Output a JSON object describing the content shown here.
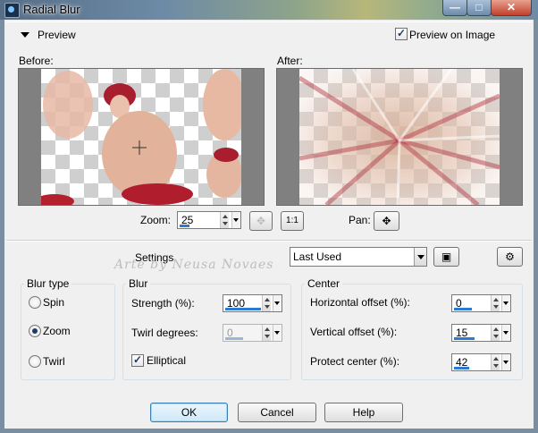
{
  "window": {
    "title": "Radial Blur",
    "min_label": "—",
    "max_label": "□",
    "close_label": "✕"
  },
  "preview_section": {
    "label": "Preview",
    "preview_on_image_label": "Preview on Image",
    "preview_on_image_checked": true
  },
  "before_label": "Before:",
  "after_label": "After:",
  "zoom": {
    "label": "Zoom:",
    "value": "25",
    "level_fraction": 0.25
  },
  "pan": {
    "label": "Pan:"
  },
  "reset_zoom_label": "1:1",
  "settings": {
    "label": "Settings",
    "preset_value": "Last Used"
  },
  "watermark_text": "Arte by Neusa Novaes",
  "blur_type": {
    "title": "Blur type",
    "options": [
      {
        "label": "Spin",
        "selected": false
      },
      {
        "label": "Zoom",
        "selected": true
      },
      {
        "label": "Twirl",
        "selected": false
      }
    ]
  },
  "blur": {
    "title": "Blur",
    "strength": {
      "label": "Strength (%):",
      "value": "100",
      "level_fraction": 1.0
    },
    "twirl": {
      "label": "Twirl degrees:",
      "value": "0",
      "level_fraction": 0.5,
      "disabled": true
    },
    "elliptical": {
      "label": "Elliptical",
      "checked": true
    }
  },
  "center": {
    "title": "Center",
    "horizontal": {
      "label": "Horizontal offset (%):",
      "value": "0",
      "level_fraction": 0.5
    },
    "vertical": {
      "label": "Vertical offset (%):",
      "value": "15",
      "level_fraction": 0.58
    },
    "protect": {
      "label": "Protect center (%):",
      "value": "42",
      "level_fraction": 0.42
    }
  },
  "buttons": {
    "ok": "OK",
    "cancel": "Cancel",
    "help": "Help"
  },
  "colors": {
    "accent": "#2b7bd6",
    "title_bar": "#6d8aa6",
    "close_button": "#c2402b",
    "dialog_bg": "#f0f0f0"
  }
}
